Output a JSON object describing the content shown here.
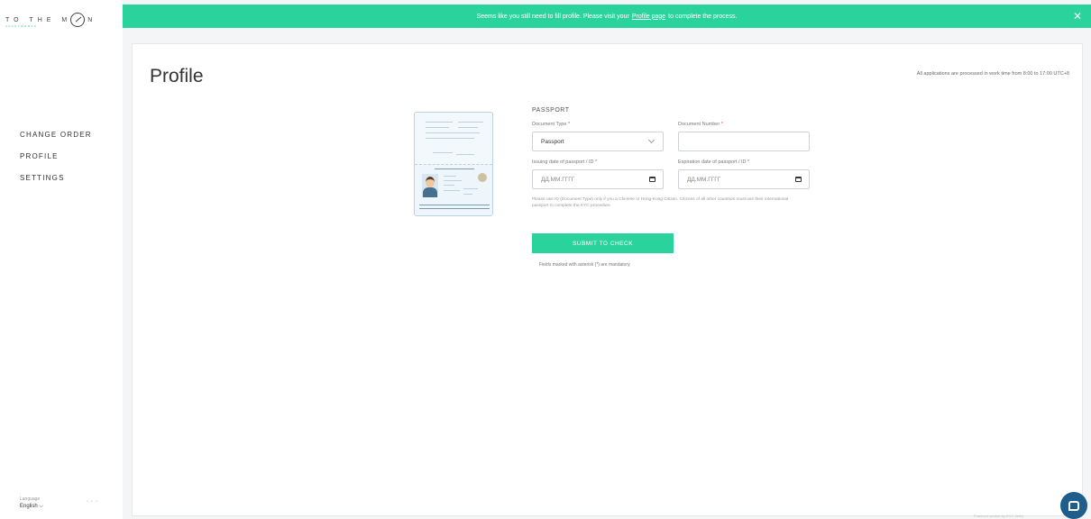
{
  "logo": {
    "text": "TO THE M",
    "text_end": "N",
    "sub": "APARTMENTS"
  },
  "sidebar": {
    "items": [
      {
        "label": "CHANGE ORDER"
      },
      {
        "label": "PROFILE"
      },
      {
        "label": "SETTINGS"
      }
    ],
    "language_label": "Language",
    "language_value": "English ⌵",
    "dots": "• • •"
  },
  "notice": {
    "text_before": "Seems like you still need to fill profile. Please visit your",
    "link": "Profile page",
    "text_after": "to complete the process.",
    "close": "✕"
  },
  "main": {
    "title": "Profile",
    "work_time": "All applications are processed in work time from 8:00 to 17:00 UTC+8"
  },
  "form": {
    "section": "PASSPORT",
    "document_type_label": "Document Type",
    "document_type_value": "Passport",
    "document_number_label": "Document Number",
    "issuing_date_label": "Issuing date of passport / ID",
    "issuing_date_placeholder": "ДД.ММ.ГГГГ",
    "expiration_date_label": "Expiration date of passport / ID",
    "expiration_date_placeholder": "ДД.ММ.ГГГГ",
    "required_mark": "*",
    "help": "Please use ID (Document Type) only if you a Chinese or Hong-Kong Citizen. Citizens of all other countries must use their international passport to complete the KYC procedure.",
    "submit": "SUBMIT TO CHECK",
    "note": "Fields marked with asterisk (*) are mandatory"
  },
  "footer": {
    "powered": "Powered service by KYC Verify"
  },
  "colors": {
    "accent": "#2bd39c",
    "chat": "#1f5d8c"
  },
  "icons": [
    "moon-logo-icon",
    "close-icon",
    "chevron-down-icon",
    "calendar-icon",
    "chat-icon",
    "passport-illustration"
  ]
}
